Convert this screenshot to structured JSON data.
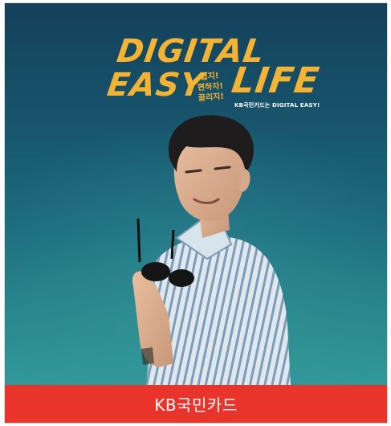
{
  "ad": {
    "headline_line1": "DIGITAL",
    "headline_line2": "EASY",
    "headline_line3": "LIFE",
    "tagline": [
      "쉽지!",
      "편하자!",
      "끌리지!"
    ],
    "subline": "KB국민카드는 DIGITAL EASY!",
    "colors": {
      "headline": "#f5b333",
      "background_top": "#14405a",
      "background_bottom": "#33989a"
    }
  },
  "caption": {
    "label": "KB국민카드",
    "background": "#e8342a"
  }
}
